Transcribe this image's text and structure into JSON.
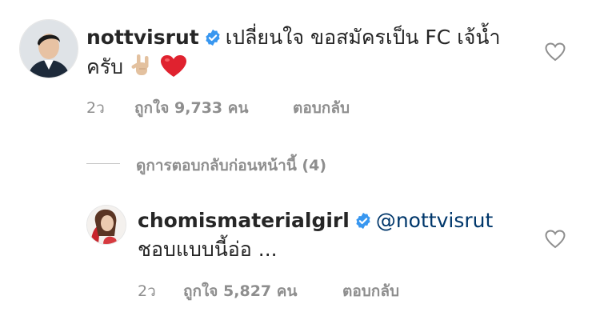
{
  "comments": [
    {
      "username": "nottvisrut",
      "text_line1": "เปลี่ยนใจ ขอสมัครเป็น FC เจ้น้ำ",
      "text_line2": "ครับ",
      "emojis": [
        "love-you-gesture-emoji",
        "red-heart-emoji"
      ],
      "time": "2ว",
      "likes": "ถูกใจ 9,733 คน",
      "reply_label": "ตอบกลับ"
    }
  ],
  "view_replies": "ดูการตอบกลับก่อนหน้านี้ (4)",
  "replies": [
    {
      "username": "chomismaterialgirl",
      "mention": "@nottvisrut",
      "text": "ชอบแบบนี้อ่อ ...",
      "time": "2ว",
      "likes": "ถูกใจ 5,827 คน",
      "reply_label": "ตอบกลับ"
    }
  ],
  "colors": {
    "verified": "#3897f0",
    "secondary_text": "#8e8e8e",
    "mention": "#00376b",
    "emoji_heart": "#e0222f"
  }
}
